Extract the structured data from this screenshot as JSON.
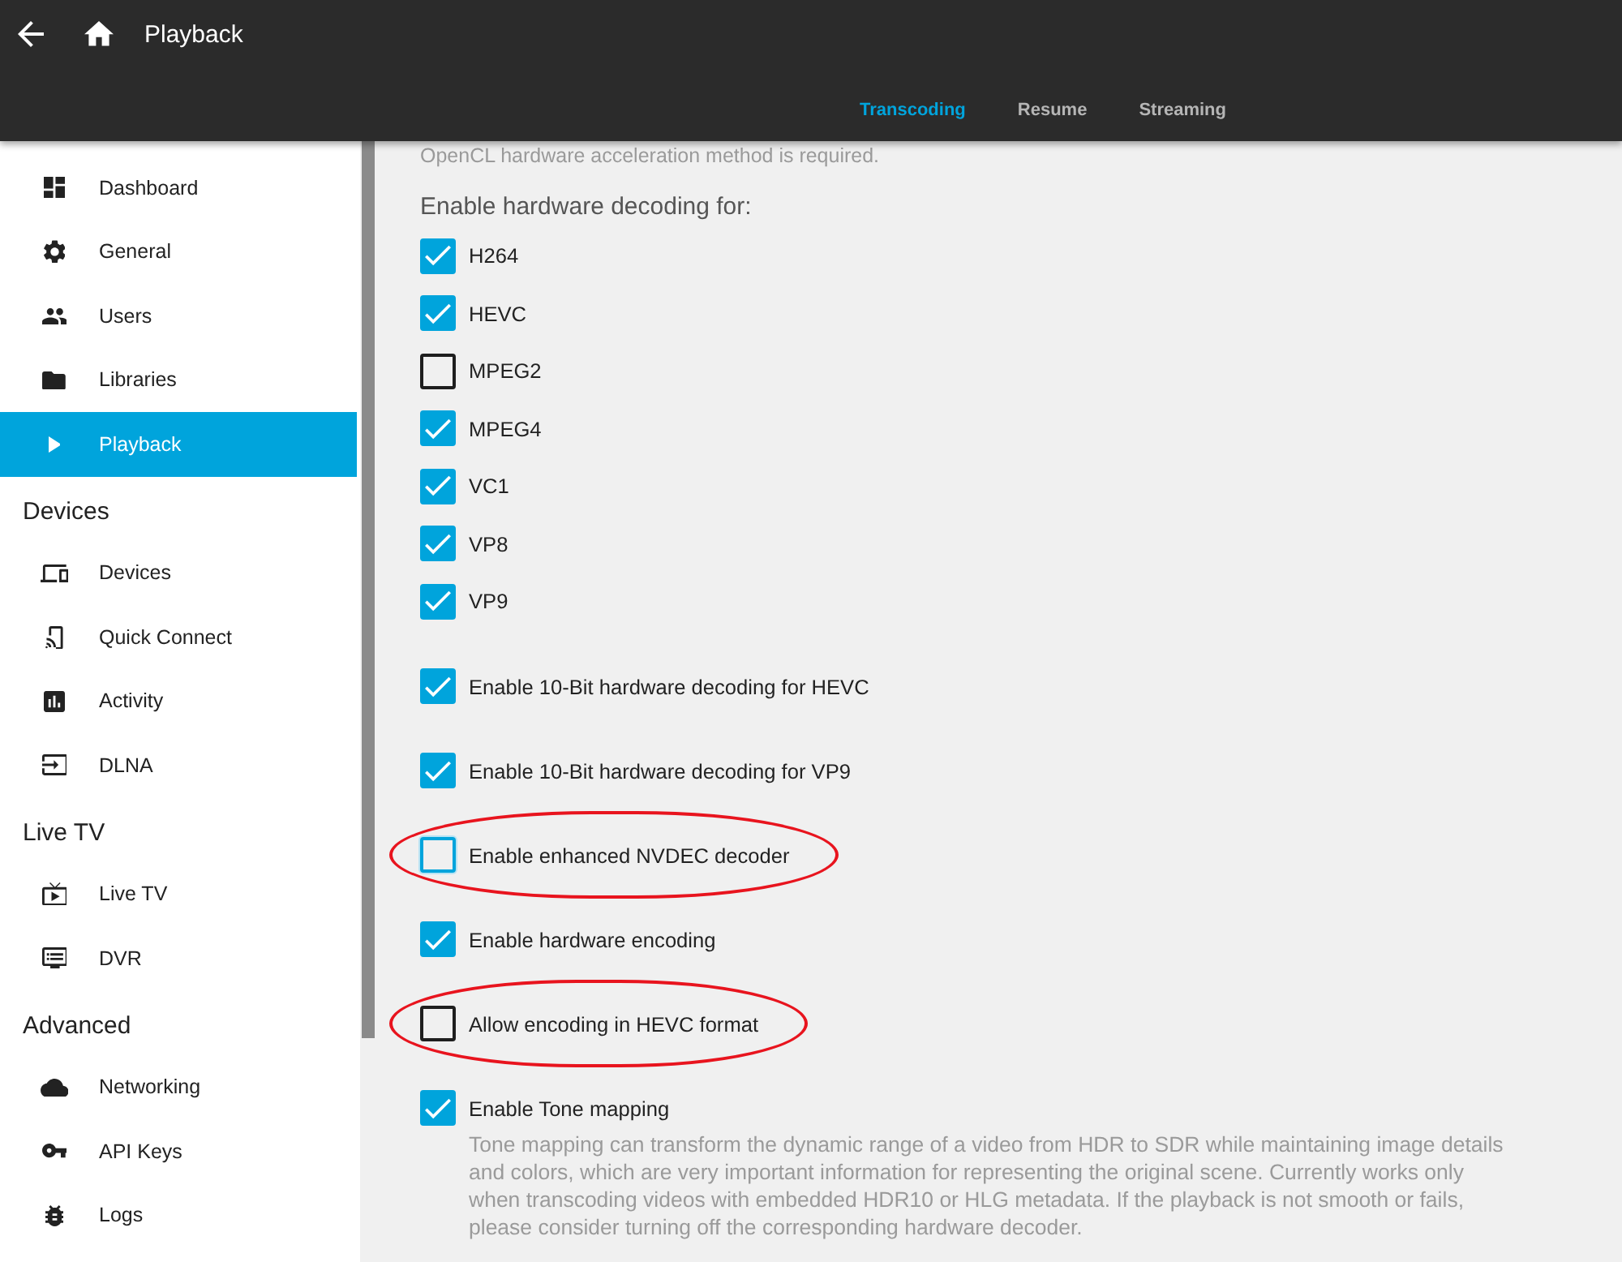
{
  "header": {
    "title": "Playback",
    "tabs": [
      {
        "label": "Transcoding",
        "selected": true
      },
      {
        "label": "Resume",
        "selected": false
      },
      {
        "label": "Streaming",
        "selected": false
      }
    ]
  },
  "sidebar": {
    "sections": [
      {
        "items": [
          {
            "label": "Dashboard",
            "selected": false
          },
          {
            "label": "General",
            "selected": false
          },
          {
            "label": "Users",
            "selected": false
          },
          {
            "label": "Libraries",
            "selected": false
          },
          {
            "label": "Playback",
            "selected": true
          }
        ]
      },
      {
        "heading": "Devices",
        "items": [
          {
            "label": "Devices",
            "selected": false
          },
          {
            "label": "Quick Connect",
            "selected": false
          },
          {
            "label": "Activity",
            "selected": false
          },
          {
            "label": "DLNA",
            "selected": false
          }
        ]
      },
      {
        "heading": "Live TV",
        "items": [
          {
            "label": "Live TV",
            "selected": false
          },
          {
            "label": "DVR",
            "selected": false
          }
        ]
      },
      {
        "heading": "Advanced",
        "items": [
          {
            "label": "Networking",
            "selected": false
          },
          {
            "label": "API Keys",
            "selected": false
          },
          {
            "label": "Logs",
            "selected": false
          }
        ]
      }
    ]
  },
  "content": {
    "note": "OpenCL hardware acceleration method is required.",
    "decoding": {
      "heading": "Enable hardware decoding for:",
      "codecs": [
        {
          "label": "H264",
          "checked": true
        },
        {
          "label": "HEVC",
          "checked": true
        },
        {
          "label": "MPEG2",
          "checked": false
        },
        {
          "label": "MPEG4",
          "checked": true
        },
        {
          "label": "VC1",
          "checked": true
        },
        {
          "label": "VP8",
          "checked": true
        },
        {
          "label": "VP9",
          "checked": true
        }
      ]
    },
    "options": [
      {
        "label": "Enable 10-Bit hardware decoding for HEVC",
        "checked": true,
        "focused": false,
        "circled": false
      },
      {
        "label": "Enable 10-Bit hardware decoding for VP9",
        "checked": true,
        "focused": false,
        "circled": false
      },
      {
        "label": "Enable enhanced NVDEC decoder",
        "checked": false,
        "focused": true,
        "circled": true
      },
      {
        "label": "Enable hardware encoding",
        "checked": true,
        "focused": false,
        "circled": false
      },
      {
        "label": "Allow encoding in HEVC format",
        "checked": false,
        "focused": false,
        "circled": true
      },
      {
        "label": "Enable Tone mapping",
        "checked": true,
        "focused": false,
        "circled": false,
        "description": "Tone mapping can transform the dynamic range of a video from HDR to SDR while maintaining image details and colors, which are very important information for representing the original scene. Currently works only when transcoding videos with embedded HDR10 or HLG metadata. If the playback is not smooth or fails, please consider turning off the corresponding hardware decoder."
      }
    ]
  }
}
